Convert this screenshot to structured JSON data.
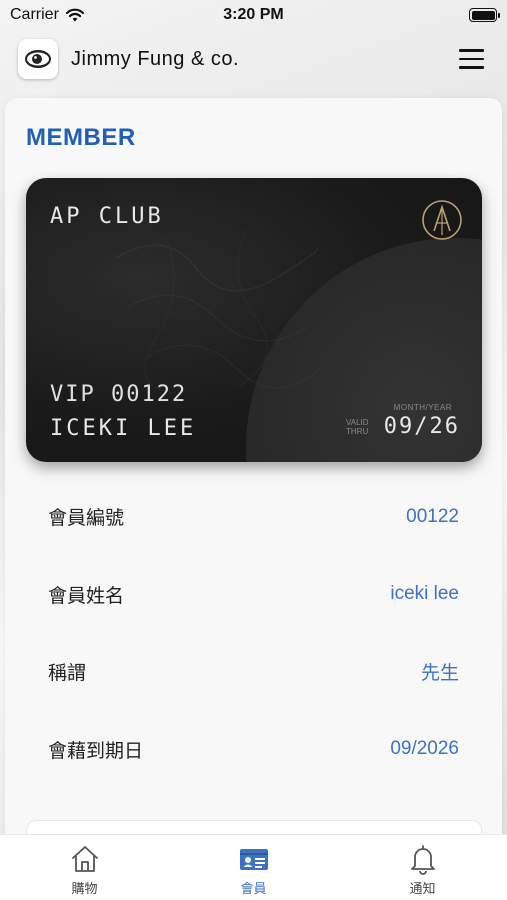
{
  "status_bar": {
    "carrier": "Carrier",
    "time": "3:20 PM"
  },
  "header": {
    "title": "Jimmy Fung & co."
  },
  "section": {
    "heading": "MEMBER"
  },
  "card": {
    "brand": "AP CLUB",
    "vip_line": "VIP 00122",
    "name": "ICEKI LEE",
    "expiry_caption": "MONTH/YEAR",
    "valid_label_1": "VALID",
    "valid_label_2": "THRU",
    "expiry": "09/26"
  },
  "info": [
    {
      "label": "會員編號",
      "value": "00122"
    },
    {
      "label": "會員姓名",
      "value": "iceki lee"
    },
    {
      "label": "稱謂",
      "value": "先生"
    },
    {
      "label": "會藉到期日",
      "value": "09/2026"
    }
  ],
  "tabs": [
    {
      "label": "購物",
      "icon": "home-icon"
    },
    {
      "label": "會員",
      "icon": "member-card-icon"
    },
    {
      "label": "通知",
      "icon": "bell-icon"
    }
  ],
  "colors": {
    "accent": "#3d72c2",
    "heading": "#1f5fb5",
    "card": "#1a1a1a"
  }
}
